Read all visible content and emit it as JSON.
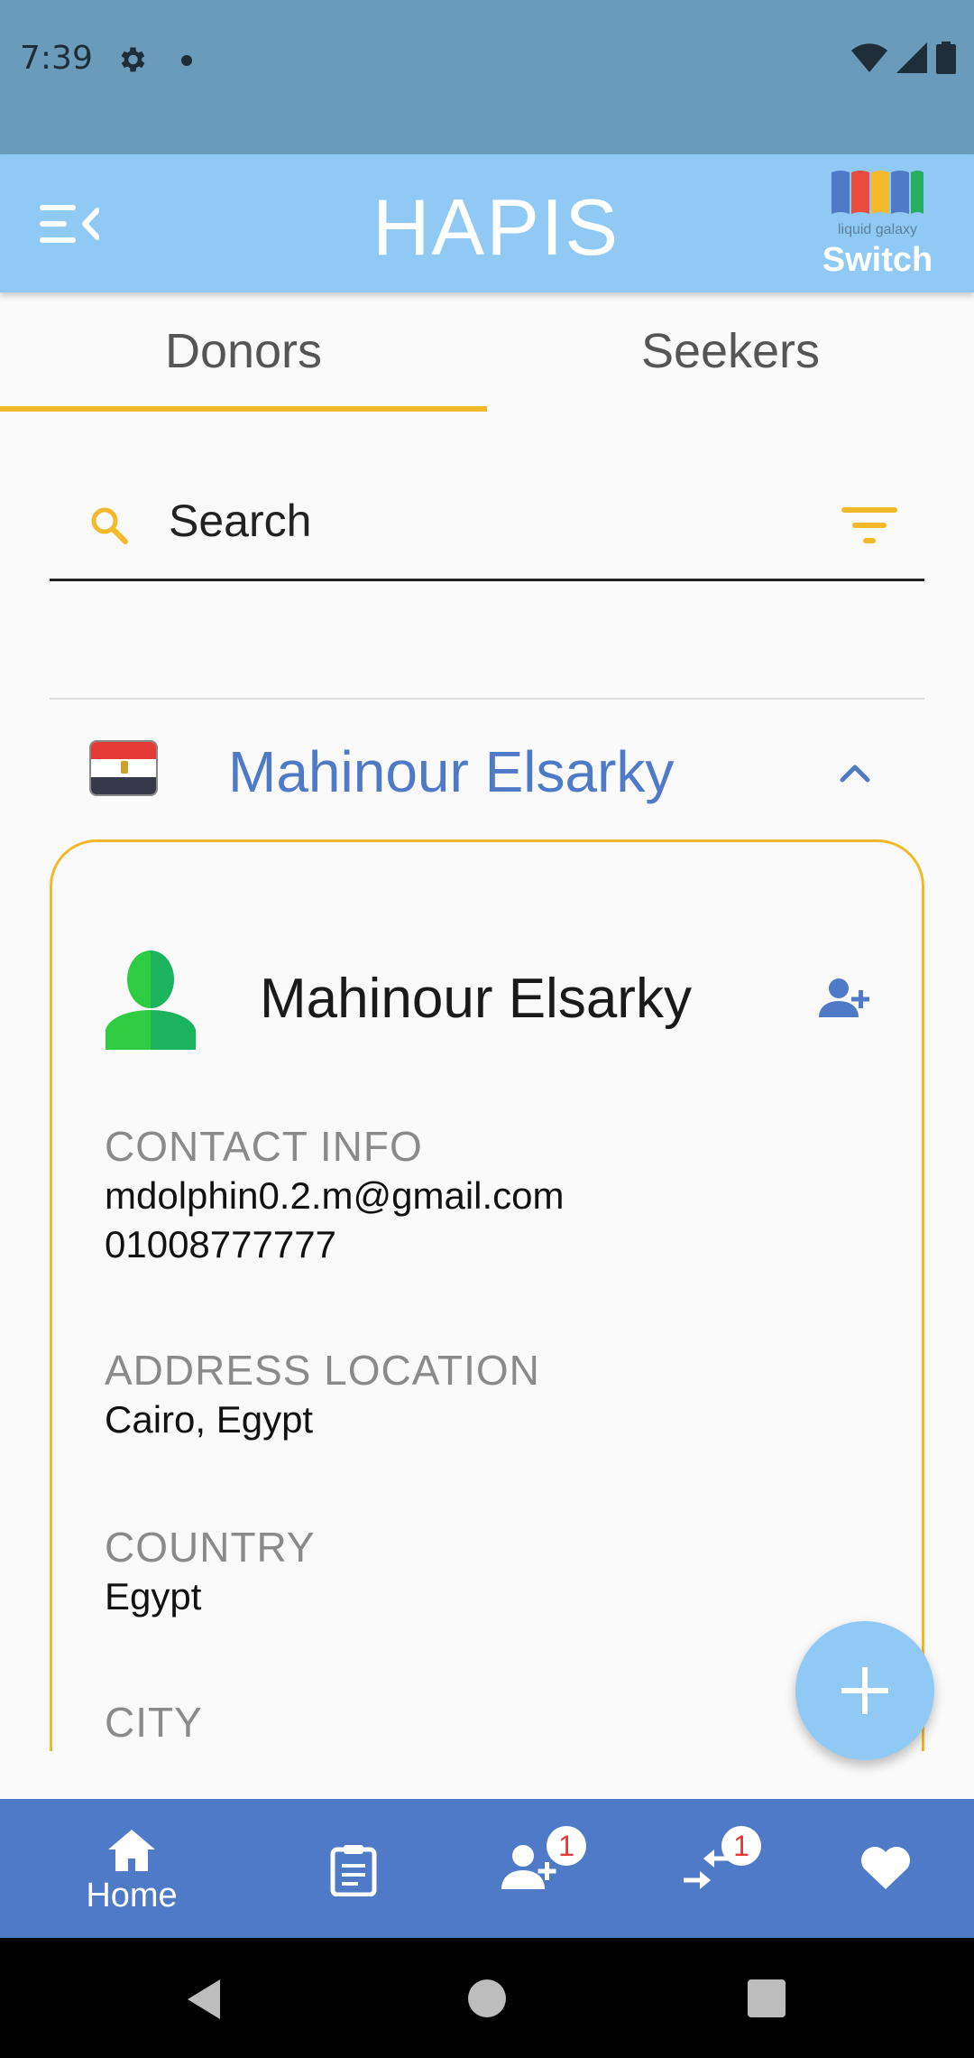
{
  "status_bar": {
    "time": "7:39"
  },
  "app_bar": {
    "title": "HAPIS",
    "switch_label": "Switch",
    "logo_text": "liquid galaxy"
  },
  "tabs": [
    {
      "label": "Donors"
    },
    {
      "label": "Seekers"
    }
  ],
  "search": {
    "placeholder": "Search"
  },
  "accordion": {
    "name": "Mahinour Elsarky",
    "flag": "egypt-flag"
  },
  "card": {
    "name": "Mahinour Elsarky",
    "fields": [
      {
        "label": "CONTACT INFO",
        "lines": [
          "mdolphin0.2.m@gmail.com",
          "01008777777"
        ]
      },
      {
        "label": "ADDRESS LOCATION",
        "lines": [
          "Cairo, Egypt"
        ]
      },
      {
        "label": "COUNTRY",
        "lines": [
          "Egypt"
        ]
      },
      {
        "label": "CITY",
        "lines": []
      }
    ]
  },
  "bottom_nav": {
    "home_label": "Home",
    "requests_badge": "1",
    "transfers_badge": "1"
  },
  "colors": {
    "accent": "#f4b92a",
    "primary": "#4f7ac8",
    "app_bar": "#90caf4",
    "status_bar": "#6b9bbb"
  }
}
